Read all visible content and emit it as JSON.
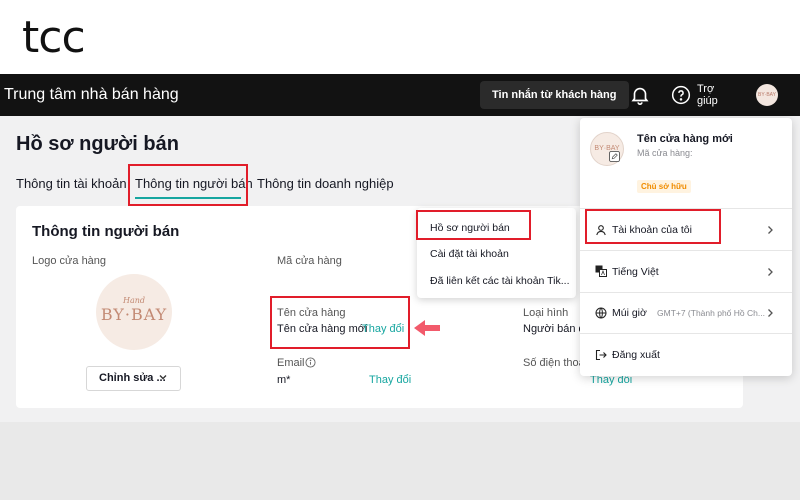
{
  "brand": {
    "logo_text": "tcc"
  },
  "header": {
    "title": "Trung tâm nhà bán hàng",
    "messages_button": "Tin nhắn từ khách hàng",
    "help_label": "Trợ giúp",
    "avatar_text": "BY·BAY"
  },
  "page": {
    "title": "Hồ sơ người bán",
    "tabs": [
      {
        "label": "Thông tin tài khoản"
      },
      {
        "label": "Thông tin người bán"
      },
      {
        "label": "Thông tin doanh nghiệp"
      }
    ]
  },
  "card": {
    "title": "Thông tin người bán",
    "logo_label": "Logo cửa hàng",
    "logo_script": "Hand",
    "logo_text": "BY·BAY",
    "edit_button": "Chỉnh sửa ...",
    "shop_code_label": "Mã cửa hàng",
    "shop_name_label": "Tên cửa hàng",
    "shop_name_value": "Tên cửa hàng mới",
    "shop_name_change": "Thay đổi",
    "email_label": "Email",
    "email_value": "m*",
    "email_change": "Thay đổi",
    "type_label": "Loại hình",
    "type_value": "Người bán d",
    "phone_label": "Số điện thoạ",
    "phone_change": "Thay đổi"
  },
  "dropdown": {
    "items": [
      {
        "label": "Hồ sơ người bán"
      },
      {
        "label": "Cài đặt tài khoản"
      },
      {
        "label": "Đã liên kết các tài khoản Tik..."
      }
    ]
  },
  "account_panel": {
    "shop_name": "Tên cửa hàng mới",
    "shop_code": "Mã cửa hàng:",
    "owner_badge": "Chủ sở hữu",
    "my_account": "Tài khoản của tôi",
    "language": "Tiếng Việt",
    "timezone_label": "Múi giờ",
    "timezone_value": "GMT+7 (Thành phố Hồ Ch...",
    "logout": "Đăng xuất"
  },
  "colors": {
    "accent": "#16a6a0",
    "highlight": "#e11d2a",
    "header_bg": "#121212",
    "badge": "#f08c00"
  }
}
